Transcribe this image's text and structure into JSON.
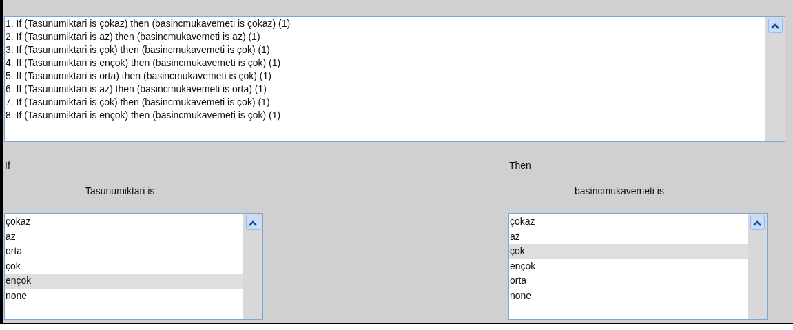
{
  "rules": [
    {
      "text": "1. If (Tasunumiktari is çokaz) then (basincmukavemeti is çokaz) (1)"
    },
    {
      "text": "2. If (Tasunumiktari is az) then (basincmukavemeti is az) (1)"
    },
    {
      "text": "3. If (Tasunumiktari is çok) then (basincmukavemeti is çok) (1)"
    },
    {
      "text": "4. If (Tasunumiktari is ençok) then (basincmukavemeti is çok) (1)"
    },
    {
      "text": "5. If (Tasunumiktari is orta) then (basincmukavemeti is çok) (1)"
    },
    {
      "text": "6. If (Tasunumiktari is az) then (basincmukavemeti is orta) (1)"
    },
    {
      "text": "7. If (Tasunumiktari is çok) then (basincmukavemeti is çok) (1)"
    },
    {
      "text": "8. If (Tasunumiktari is ençok) then (basincmukavemeti is çok) (1)"
    }
  ],
  "if_section": {
    "label": "If",
    "variable_label": "Tasunumiktari is",
    "options": [
      {
        "label": "çokaz",
        "selected": false
      },
      {
        "label": "az",
        "selected": false
      },
      {
        "label": "orta",
        "selected": false
      },
      {
        "label": "çok",
        "selected": false
      },
      {
        "label": "ençok",
        "selected": true
      },
      {
        "label": "none",
        "selected": false
      }
    ]
  },
  "then_section": {
    "label": "Then",
    "variable_label": "basincmukavemeti is",
    "options": [
      {
        "label": "çokaz",
        "selected": false
      },
      {
        "label": "az",
        "selected": false
      },
      {
        "label": "çok",
        "selected": true
      },
      {
        "label": "ençok",
        "selected": false
      },
      {
        "label": "orta",
        "selected": false
      },
      {
        "label": "none",
        "selected": false
      }
    ]
  }
}
